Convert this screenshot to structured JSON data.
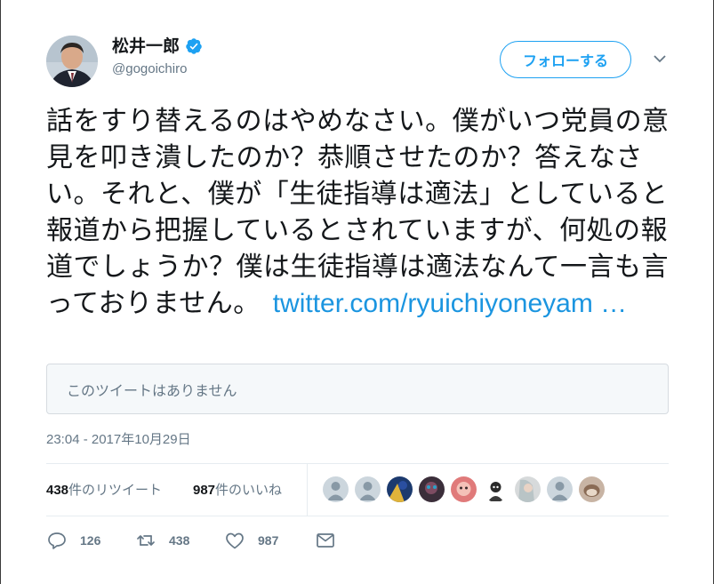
{
  "user": {
    "display_name": "松井一郎",
    "screen_name": "@gogoichiro",
    "verified": true
  },
  "follow_button": {
    "label": "フォローする"
  },
  "tweet": {
    "text": "話をすり替えるのはやめなさい。僕がいつ党員の意見を叩き潰したのか？恭順させたのか？答えなさい。それと、僕が「生徒指導は適法」としていると報道から把握しているとされていますが、何処の報道でしょうか？僕は生徒指導は適法なんて一言も言っておりません。",
    "link": "twitter.com/ryuichiyoneyam …",
    "unavailable_notice": "このツイートはありません",
    "timestamp": "23:04 - 2017年10月29日"
  },
  "stats": {
    "retweet_count": "438",
    "retweet_label": "件のリツイート",
    "like_count": "987",
    "like_label": "件のいいね"
  },
  "likers": [
    "default-avatar-icon",
    "default-avatar-icon",
    "user-avatar",
    "user-avatar",
    "user-avatar",
    "user-avatar",
    "user-avatar",
    "default-avatar-icon",
    "user-avatar"
  ],
  "actions": {
    "reply_count": "126",
    "retweet_count": "438",
    "like_count": "987"
  },
  "colors": {
    "accent": "#1da1f2",
    "link": "#1b95e0",
    "secondary_text": "#657786",
    "primary_text": "#14171a"
  }
}
